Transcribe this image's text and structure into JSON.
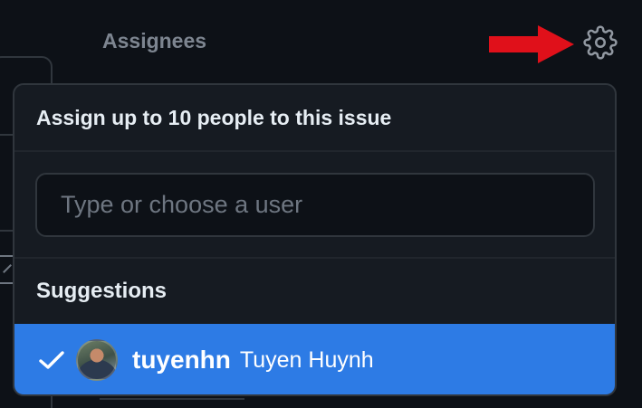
{
  "sidebar": {
    "assignees_heading": "Assignees"
  },
  "assignee_menu": {
    "title": "Assign up to 10 people to this issue",
    "filter": {
      "placeholder": "Type or choose a user",
      "value": ""
    },
    "suggestions_label": "Suggestions",
    "suggestions": [
      {
        "login": "tuyenhn",
        "full_name": "Tuyen Huynh",
        "selected": true
      }
    ]
  },
  "icons": {
    "settings": "gear-icon",
    "annotation": "red-arrow-icon",
    "selected": "check-icon"
  },
  "colors": {
    "background": "#0d1117",
    "panel": "#161b22",
    "border": "#30363d",
    "selected_row": "#2d7be5",
    "annotation_arrow": "#e0101a",
    "muted_text": "#7d8590"
  }
}
